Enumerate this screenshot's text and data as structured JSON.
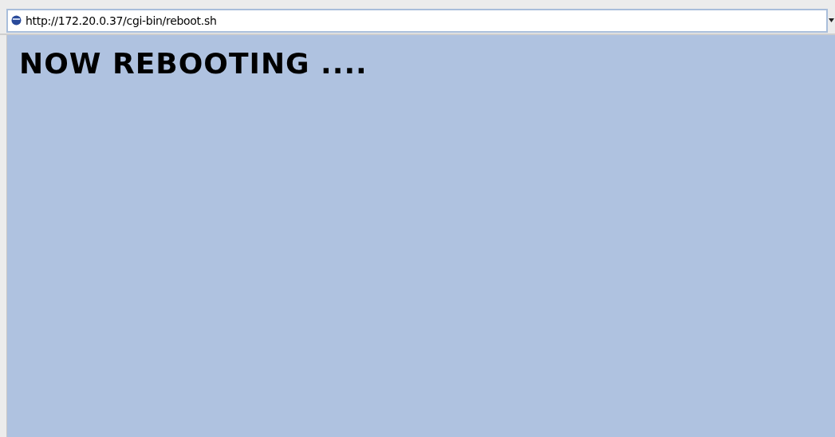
{
  "address_bar": {
    "value": "http://172.20.0.37/cgi-bin/reboot.sh"
  },
  "page": {
    "heading": "NOW REBOOTING ...."
  }
}
